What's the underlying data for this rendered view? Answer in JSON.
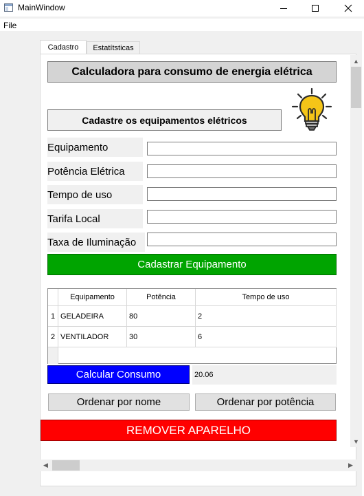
{
  "window": {
    "title": "MainWindow",
    "minimize_glyph": "",
    "maximize_glyph": "",
    "close_glyph": ""
  },
  "menubar": {
    "file": "File"
  },
  "tabs": [
    {
      "label": "Cadastro",
      "active": true
    },
    {
      "label": "Estatítsticas",
      "active": false
    }
  ],
  "main_title": "Calculadora para consumo de energia elétrica",
  "section_title": "Cadastre os equipamentos elétricos",
  "icons": {
    "bulb": "lightbulb-icon"
  },
  "form": {
    "fields": [
      {
        "label": "Equipamento",
        "value": ""
      },
      {
        "label": "Potência Elétrica",
        "value": ""
      },
      {
        "label": "Tempo de uso",
        "value": ""
      },
      {
        "label": "Tarifa Local",
        "value": ""
      },
      {
        "label": "Taxa de Iluminação",
        "value": ""
      }
    ],
    "submit_label": "Cadastrar Equipamento"
  },
  "table": {
    "headers": [
      "Equipamento",
      "Potência",
      "Tempo de uso"
    ],
    "rows": [
      {
        "num": "1",
        "cells": [
          "GELADEIRA",
          "80",
          "2"
        ]
      },
      {
        "num": "2",
        "cells": [
          "VENTILADOR",
          "30",
          "6"
        ]
      }
    ]
  },
  "calc": {
    "button_label": "Calcular Consumo",
    "result": "20.06"
  },
  "sort": {
    "by_name": "Ordenar por nome",
    "by_power": "Ordenar por potência"
  },
  "remove_label": "REMOVER APARELHO",
  "colors": {
    "green_button": "#00a400",
    "blue_button": "#0000ff",
    "red_button": "#ff0000",
    "bulb_yellow": "#f5c518"
  }
}
